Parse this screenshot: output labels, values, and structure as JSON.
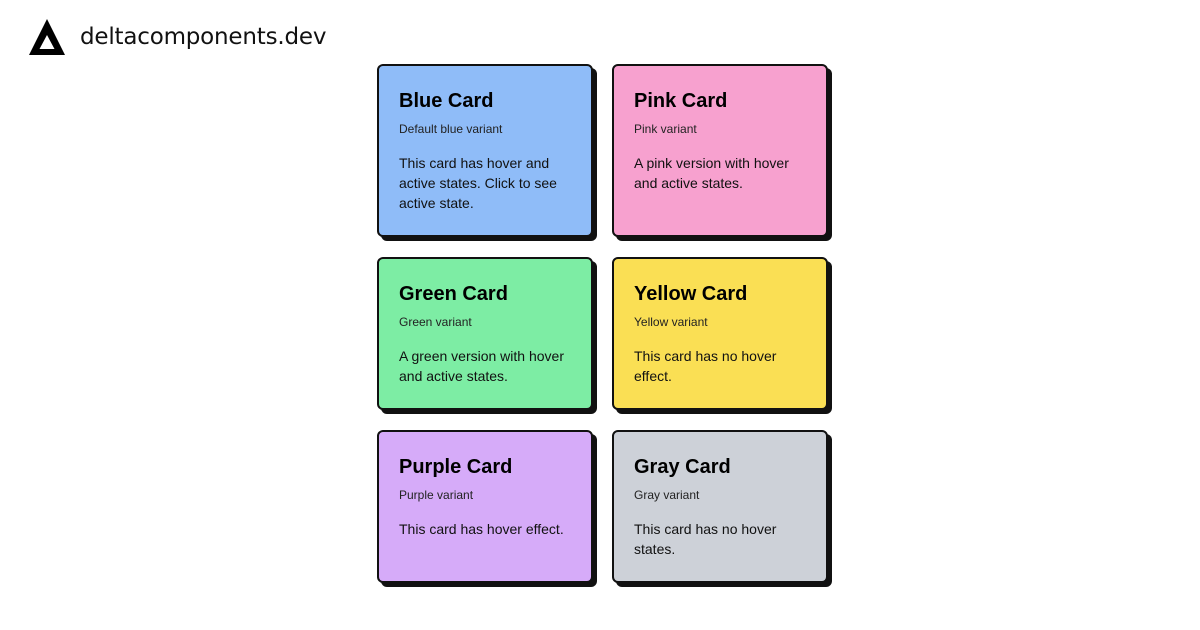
{
  "brand": {
    "name": "deltacomponents.dev",
    "logo_icon": "delta-triangle-icon"
  },
  "cards": [
    {
      "title": "Blue Card",
      "subtitle": "Default blue variant",
      "body": "This card has hover and active states. Click to see active state.",
      "color": "#8FBCF8"
    },
    {
      "title": "Pink Card",
      "subtitle": "Pink variant",
      "body": "A pink version with hover and active states.",
      "color": "#F7A1CF"
    },
    {
      "title": "Green Card",
      "subtitle": "Green variant",
      "body": "A green version with hover and active states.",
      "color": "#7DEDA4"
    },
    {
      "title": "Yellow Card",
      "subtitle": "Yellow variant",
      "body": "This card has no hover effect.",
      "color": "#FADF54"
    },
    {
      "title": "Purple Card",
      "subtitle": "Purple variant",
      "body": "This card has hover effect.",
      "color": "#D6ABF9"
    },
    {
      "title": "Gray Card",
      "subtitle": "Gray variant",
      "body": "This card has no hover states.",
      "color": "#CDD1D8"
    }
  ]
}
